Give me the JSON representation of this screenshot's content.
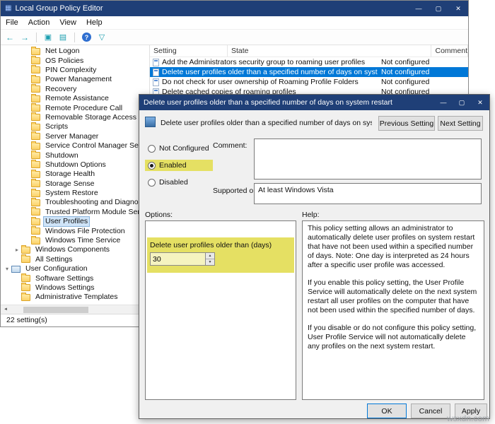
{
  "icons": {
    "app": "▦",
    "minimize": "—",
    "maximize": "▢",
    "close": "✕",
    "back": "←",
    "forward": "→",
    "console_tree": "▣",
    "export_list": "▤",
    "help": "?",
    "filter": "▽",
    "spin_up": "▲",
    "spin_down": "▼",
    "scroll_left": "◄",
    "scroll_right": "►"
  },
  "colors": {
    "titlebar": "#1f3f77",
    "selection": "#0078d7",
    "highlight": "#e5e063"
  },
  "main_window": {
    "title": "Local Group Policy Editor",
    "menu_items": [
      {
        "label": "File"
      },
      {
        "label": "Action"
      },
      {
        "label": "View"
      },
      {
        "label": "Help"
      }
    ],
    "tree": {
      "items": [
        {
          "label": "Net Logon",
          "indent": 2,
          "icon": "folder"
        },
        {
          "label": "OS Policies",
          "indent": 2,
          "icon": "folder"
        },
        {
          "label": "PIN Complexity",
          "indent": 2,
          "icon": "folder"
        },
        {
          "label": "Power Management",
          "indent": 2,
          "icon": "folder"
        },
        {
          "label": "Recovery",
          "indent": 2,
          "icon": "folder"
        },
        {
          "label": "Remote Assistance",
          "indent": 2,
          "icon": "folder"
        },
        {
          "label": "Remote Procedure Call",
          "indent": 2,
          "icon": "folder"
        },
        {
          "label": "Removable Storage Access",
          "indent": 2,
          "icon": "folder"
        },
        {
          "label": "Scripts",
          "indent": 2,
          "icon": "folder"
        },
        {
          "label": "Server Manager",
          "indent": 2,
          "icon": "folder"
        },
        {
          "label": "Service Control Manager Settings",
          "indent": 2,
          "icon": "folder"
        },
        {
          "label": "Shutdown",
          "indent": 2,
          "icon": "folder"
        },
        {
          "label": "Shutdown Options",
          "indent": 2,
          "icon": "folder"
        },
        {
          "label": "Storage Health",
          "indent": 2,
          "icon": "folder"
        },
        {
          "label": "Storage Sense",
          "indent": 2,
          "icon": "folder"
        },
        {
          "label": "System Restore",
          "indent": 2,
          "icon": "folder"
        },
        {
          "label": "Troubleshooting and Diagnostics",
          "indent": 2,
          "icon": "folder"
        },
        {
          "label": "Trusted Platform Module Services",
          "indent": 2,
          "icon": "folder"
        },
        {
          "label": "User Profiles",
          "indent": 2,
          "icon": "folder",
          "selected": true
        },
        {
          "label": "Windows File Protection",
          "indent": 2,
          "icon": "folder"
        },
        {
          "label": "Windows Time Service",
          "indent": 2,
          "icon": "folder"
        },
        {
          "label": "Windows Components",
          "indent": 1,
          "icon": "folder",
          "expander": "▸"
        },
        {
          "label": "All Settings",
          "indent": 1,
          "icon": "folder"
        },
        {
          "label": "User Configuration",
          "indent": 0,
          "icon": "console",
          "expander": "▾"
        },
        {
          "label": "Software Settings",
          "indent": 1,
          "icon": "folder"
        },
        {
          "label": "Windows Settings",
          "indent": 1,
          "icon": "folder"
        },
        {
          "label": "Administrative Templates",
          "indent": 1,
          "icon": "folder"
        }
      ]
    },
    "list": {
      "columns": [
        {
          "label": "Setting"
        },
        {
          "label": "State"
        },
        {
          "label": "Comment"
        }
      ],
      "rows": [
        {
          "setting": "Add the Administrators security group to roaming user profiles",
          "state": "Not configured"
        },
        {
          "setting": "Delete user profiles older than a specified number of days on system restart",
          "state": "Not configured",
          "selected": true
        },
        {
          "setting": "Do not check for user ownership of Roaming Profile Folders",
          "state": "Not configured"
        },
        {
          "setting": "Delete cached copies of roaming profiles",
          "state": "Not configured"
        }
      ]
    },
    "status_text": "22 setting(s)"
  },
  "dialog": {
    "title": "Delete user profiles older than a specified number of days on system restart",
    "header_title": "Delete user profiles older than a specified number of days on system restart",
    "previous_button": "Previous Setting",
    "next_button": "Next Setting",
    "radios": [
      {
        "label": "Not Configured"
      },
      {
        "label": "Enabled",
        "selected": true,
        "highlight": true
      },
      {
        "label": "Disabled"
      }
    ],
    "comment_label": "Comment:",
    "comment_value": "",
    "supported_label": "Supported on:",
    "supported_value": "At least Windows Vista",
    "options_label": "Options:",
    "help_label": "Help:",
    "option_field": {
      "label": "Delete user profiles older than (days)",
      "value": "30"
    },
    "help_paragraphs": [
      {
        "text": "This policy setting allows an administrator to automatically delete user profiles on system restart that have not been used within a specified number of days. Note: One day is interpreted as 24 hours after a specific user profile was accessed."
      },
      {
        "text": "If you enable this policy setting, the User Profile Service will automatically delete on the next system restart all user profiles on the computer that have not been used within the specified number of days."
      },
      {
        "text": "If you disable or do not configure this policy setting, User Profile Service will not automatically delete any profiles on the next system restart."
      }
    ],
    "ok_button": "OK",
    "cancel_button": "Cancel",
    "apply_button": "Apply"
  },
  "watermark": "wsxdn.com"
}
